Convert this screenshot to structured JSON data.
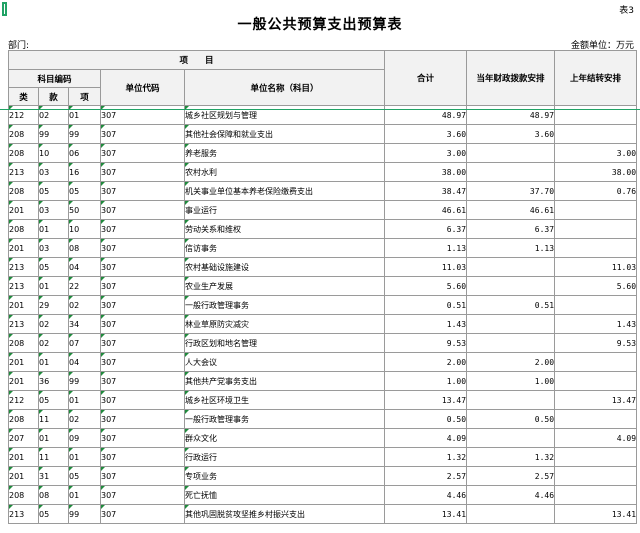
{
  "sheet_no": "表3",
  "title": "一般公共预算支出预算表",
  "dept_label": "部门:",
  "unit_label": "金额单位：万元",
  "header": {
    "project": "项　　目",
    "code_group": "科目编码",
    "lei": "类",
    "kuan": "款",
    "xiang": "项",
    "unit_code": "单位代码",
    "unit_name": "单位名称（科目）",
    "total": "合计",
    "current": "当年财政拨款安排",
    "carryover": "上年结转安排"
  },
  "rows": [
    {
      "lei": "212",
      "kuan": "02",
      "xiang": "01",
      "code": "307",
      "name": "城乡社区规划与管理",
      "total": "48.97",
      "current": "48.97",
      "carry": ""
    },
    {
      "lei": "208",
      "kuan": "99",
      "xiang": "99",
      "code": "307",
      "name": "其他社会保障和就业支出",
      "total": "3.60",
      "current": "3.60",
      "carry": ""
    },
    {
      "lei": "208",
      "kuan": "10",
      "xiang": "06",
      "code": "307",
      "name": "养老服务",
      "total": "3.00",
      "current": "",
      "carry": "3.00"
    },
    {
      "lei": "213",
      "kuan": "03",
      "xiang": "16",
      "code": "307",
      "name": "农村水利",
      "total": "38.00",
      "current": "",
      "carry": "38.00"
    },
    {
      "lei": "208",
      "kuan": "05",
      "xiang": "05",
      "code": "307",
      "name": "机关事业单位基本养老保险缴费支出",
      "total": "38.47",
      "current": "37.70",
      "carry": "0.76"
    },
    {
      "lei": "201",
      "kuan": "03",
      "xiang": "50",
      "code": "307",
      "name": "事业运行",
      "total": "46.61",
      "current": "46.61",
      "carry": ""
    },
    {
      "lei": "208",
      "kuan": "01",
      "xiang": "10",
      "code": "307",
      "name": "劳动关系和维权",
      "total": "6.37",
      "current": "6.37",
      "carry": ""
    },
    {
      "lei": "201",
      "kuan": "03",
      "xiang": "08",
      "code": "307",
      "name": "信访事务",
      "total": "1.13",
      "current": "1.13",
      "carry": ""
    },
    {
      "lei": "213",
      "kuan": "05",
      "xiang": "04",
      "code": "307",
      "name": "农村基础设施建设",
      "total": "11.03",
      "current": "",
      "carry": "11.03"
    },
    {
      "lei": "213",
      "kuan": "01",
      "xiang": "22",
      "code": "307",
      "name": "农业生产发展",
      "total": "5.60",
      "current": "",
      "carry": "5.60"
    },
    {
      "lei": "201",
      "kuan": "29",
      "xiang": "02",
      "code": "307",
      "name": "一般行政管理事务",
      "total": "0.51",
      "current": "0.51",
      "carry": ""
    },
    {
      "lei": "213",
      "kuan": "02",
      "xiang": "34",
      "code": "307",
      "name": "林业草原防灾减灾",
      "total": "1.43",
      "current": "",
      "carry": "1.43"
    },
    {
      "lei": "208",
      "kuan": "02",
      "xiang": "07",
      "code": "307",
      "name": "行政区划和地名管理",
      "total": "9.53",
      "current": "",
      "carry": "9.53"
    },
    {
      "lei": "201",
      "kuan": "01",
      "xiang": "04",
      "code": "307",
      "name": "人大会议",
      "total": "2.00",
      "current": "2.00",
      "carry": ""
    },
    {
      "lei": "201",
      "kuan": "36",
      "xiang": "99",
      "code": "307",
      "name": "其他共产党事务支出",
      "total": "1.00",
      "current": "1.00",
      "carry": ""
    },
    {
      "lei": "212",
      "kuan": "05",
      "xiang": "01",
      "code": "307",
      "name": "城乡社区环境卫生",
      "total": "13.47",
      "current": "",
      "carry": "13.47"
    },
    {
      "lei": "208",
      "kuan": "11",
      "xiang": "02",
      "code": "307",
      "name": "一般行政管理事务",
      "total": "0.50",
      "current": "0.50",
      "carry": ""
    },
    {
      "lei": "207",
      "kuan": "01",
      "xiang": "09",
      "code": "307",
      "name": "群众文化",
      "total": "4.09",
      "current": "",
      "carry": "4.09"
    },
    {
      "lei": "201",
      "kuan": "11",
      "xiang": "01",
      "code": "307",
      "name": "行政运行",
      "total": "1.32",
      "current": "1.32",
      "carry": ""
    },
    {
      "lei": "201",
      "kuan": "31",
      "xiang": "05",
      "code": "307",
      "name": "专项业务",
      "total": "2.57",
      "current": "2.57",
      "carry": ""
    },
    {
      "lei": "208",
      "kuan": "08",
      "xiang": "01",
      "code": "307",
      "name": "死亡抚恤",
      "total": "4.46",
      "current": "4.46",
      "carry": ""
    },
    {
      "lei": "213",
      "kuan": "05",
      "xiang": "99",
      "code": "307",
      "name": "其他巩固脱贫攻坚推乡村振兴支出",
      "total": "13.41",
      "current": "",
      "carry": "13.41"
    }
  ]
}
